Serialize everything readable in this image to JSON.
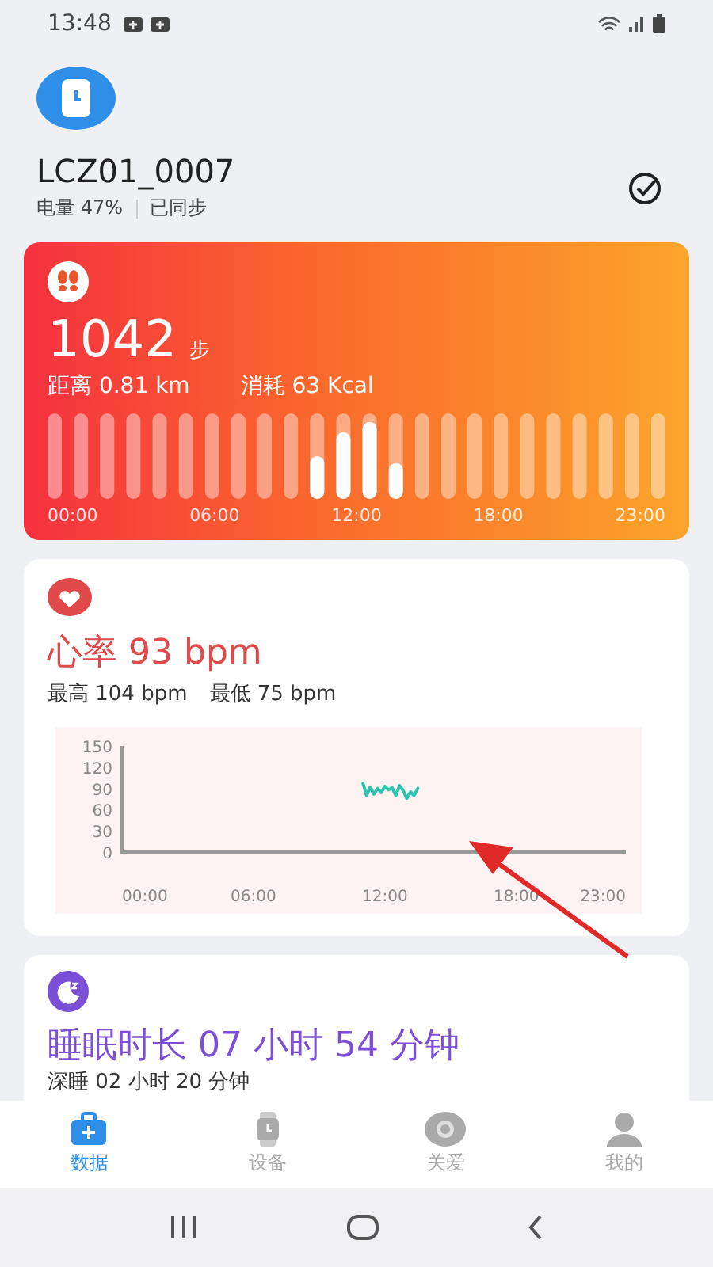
{
  "status_bar": {
    "time": "13:48"
  },
  "device": {
    "name": "LCZ01_0007",
    "battery": "电量 47%",
    "sync_status": "已同步"
  },
  "steps": {
    "count": "1042",
    "unit": "步",
    "distance": "距离 0.81 km",
    "calories": "消耗 63 Kcal",
    "time_labels": [
      "00:00",
      "06:00",
      "12:00",
      "18:00",
      "23:00"
    ]
  },
  "heart_rate": {
    "title": "心率 93 bpm",
    "max": "最高 104 bpm",
    "min": "最低 75 bpm",
    "chart_data": {
      "type": "line",
      "x": [
        11.0,
        11.17,
        11.33,
        11.5,
        11.67,
        11.83,
        12.0,
        12.17,
        12.33,
        12.5,
        12.67,
        12.83,
        13.0,
        13.17,
        13.33,
        13.5
      ],
      "series": [
        {
          "color": "#2ec4b0",
          "values": [
            97,
            80,
            92,
            82,
            90,
            84,
            93,
            88,
            91,
            80,
            94,
            87,
            76,
            85,
            80,
            90
          ]
        }
      ],
      "xlim": [
        0,
        23
      ],
      "ylim": [
        0,
        150
      ],
      "xticks": [
        {
          "value": 0,
          "label": "00:00"
        },
        {
          "value": 6,
          "label": "06:00"
        },
        {
          "value": 12,
          "label": "12:00"
        },
        {
          "value": 18,
          "label": "18:00"
        },
        {
          "value": 23,
          "label": "23:00"
        }
      ],
      "yticks": [
        0,
        30,
        60,
        90,
        120,
        150
      ]
    }
  },
  "sleep": {
    "title": "睡眠时长 07 小时 54 分钟",
    "deep_sleep": "深睡 02 小时 20 分钟"
  },
  "tabs": [
    {
      "label": "数据",
      "kind": "data",
      "selected": true
    },
    {
      "label": "设备",
      "kind": "device",
      "selected": false
    },
    {
      "label": "关爱",
      "kind": "care",
      "selected": false
    },
    {
      "label": "我的",
      "kind": "me",
      "selected": false
    }
  ]
}
